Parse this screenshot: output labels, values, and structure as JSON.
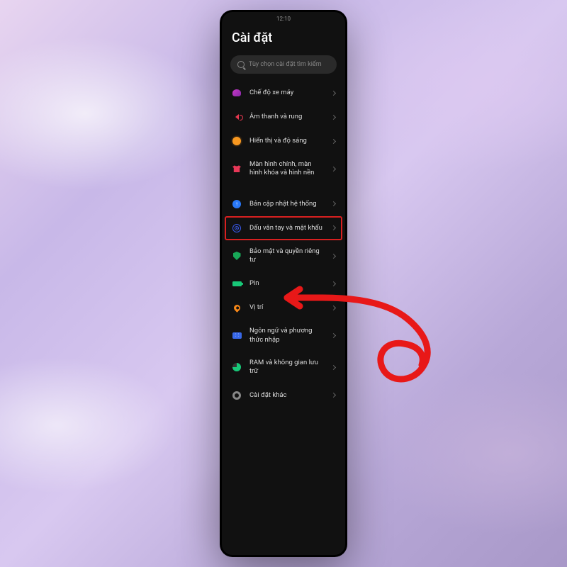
{
  "status_bar": {
    "time": "12:10"
  },
  "title": "Cài đặt",
  "search": {
    "placeholder": "Tùy chọn cài đặt tìm kiếm"
  },
  "groups": [
    {
      "items": [
        {
          "icon": "helmet-icon",
          "icon_class": "ic-helmet",
          "label": "Chế độ xe máy",
          "highlighted": false
        },
        {
          "icon": "sound-icon",
          "icon_class": "ic-sound",
          "label": "Âm thanh và rung",
          "highlighted": false
        },
        {
          "icon": "brightness-icon",
          "icon_class": "ic-sun",
          "label": "Hiển thị và độ sáng",
          "highlighted": false
        },
        {
          "icon": "wallpaper-icon",
          "icon_class": "ic-shirt",
          "label": "Màn hình chính, màn hình khóa và hình nền",
          "highlighted": false
        }
      ]
    },
    {
      "items": [
        {
          "icon": "update-icon",
          "icon_class": "ic-update",
          "label": "Bản cập nhật hệ thống",
          "highlighted": false
        },
        {
          "icon": "fingerprint-icon",
          "icon_class": "ic-finger",
          "label": "Dấu vân tay và mật khẩu",
          "highlighted": true
        },
        {
          "icon": "shield-icon",
          "icon_class": "ic-shield",
          "label": "Bảo mật và quyền riêng tư",
          "highlighted": false
        },
        {
          "icon": "battery-icon",
          "icon_class": "ic-battery",
          "label": "Pin",
          "highlighted": false
        },
        {
          "icon": "location-icon",
          "icon_class": "ic-location",
          "label": "Vị trí",
          "highlighted": false
        },
        {
          "icon": "keyboard-icon",
          "icon_class": "ic-keyboard",
          "label": "Ngôn ngữ và phương thức nhập",
          "highlighted": false
        },
        {
          "icon": "storage-icon",
          "icon_class": "ic-storage",
          "label": "RAM và không gian lưu trữ",
          "highlighted": false
        },
        {
          "icon": "gear-icon",
          "icon_class": "ic-gear",
          "label": "Cài đặt khác",
          "highlighted": false
        }
      ]
    }
  ],
  "annotation": {
    "color": "#e81818"
  }
}
